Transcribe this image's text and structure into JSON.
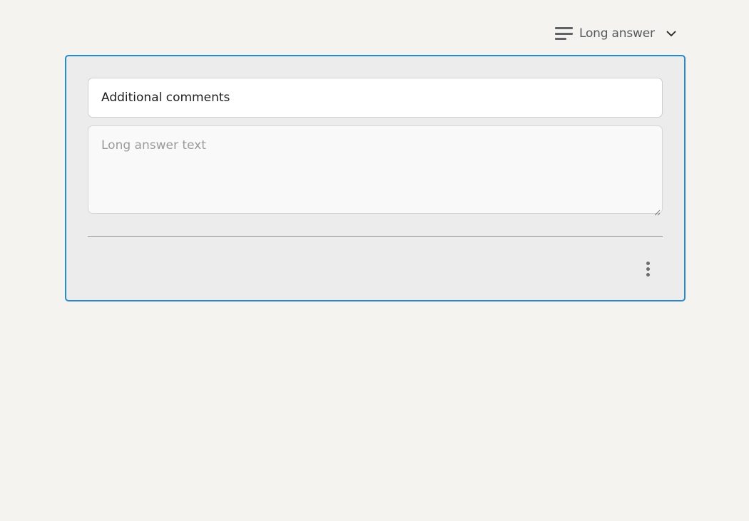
{
  "question_type": {
    "label": "Long answer",
    "icon": "short-text-lines-icon"
  },
  "question": {
    "title": "Additional comments",
    "answer_placeholder": "Long answer text"
  },
  "colors": {
    "accent": "#2a8ac9",
    "page_background": "#f4f3ef",
    "card_background": "#ececec"
  }
}
